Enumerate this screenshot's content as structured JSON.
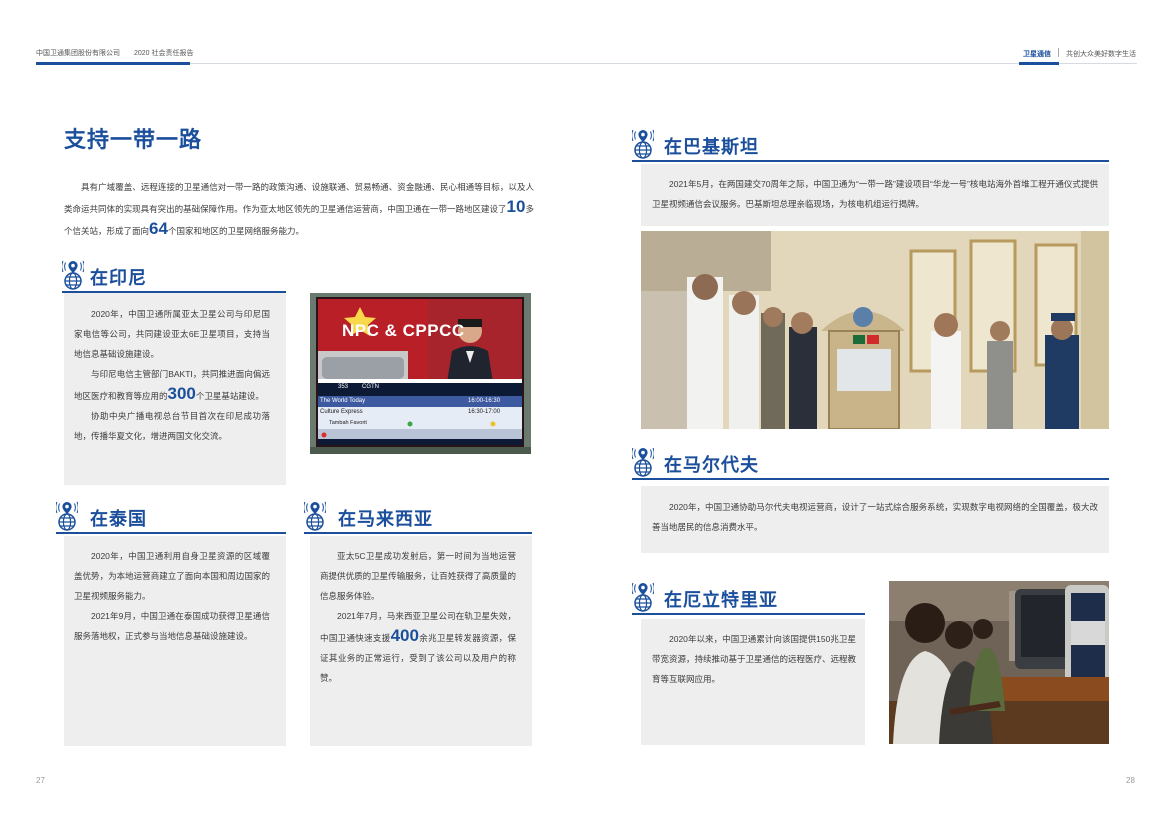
{
  "header": {
    "company": "中国卫通集团股份有限公司",
    "report": "2020 社会责任报告",
    "brand": "卫星通信",
    "slogan": "共创大众美好数字生活"
  },
  "title": "支持一带一路",
  "intro": {
    "part1": "具有广域覆盖、远程连接的卫星通信对一带一路的政策沟通、设施联通、贸易畅通、资金融通、民心相通等目标，以及人类命运共同体的实现具有突出的基础保障作用。作为亚太地区领先的卫星通信运营商，中国卫通在一带一路地区建设了",
    "num1": "10",
    "part2": "多个信关站，形成了面向",
    "num2": "64",
    "part3": "个国家和地区的卫星网络服务能力。"
  },
  "sections": {
    "indonesia": {
      "title": "在印尼",
      "p1": "2020年，中国卫通所属亚太卫星公司与印尼国家电信等公司，共同建设亚太6E卫星项目，支持当地信息基础设施建设。",
      "p2a": "与印尼电信主管部门BAKTI，共同推进面向偏远地区医疗和教育等应用的",
      "p2num": "300",
      "p2b": "个卫星基站建设。",
      "p3": "协助中央广播电视总台节目首次在印尼成功落地，传播华夏文化，增进两国文化交流。"
    },
    "thailand": {
      "title": "在泰国",
      "p1": "2020年，中国卫通利用自身卫星资源的区域覆盖优势，为本地运营商建立了面向本国和周边国家的卫星视频服务能力。",
      "p2": "2021年9月，中国卫通在泰国成功获得卫星通信服务落地权，正式参与当地信息基础设施建设。"
    },
    "malaysia": {
      "title": "在马来西亚",
      "p1": "亚太5C卫星成功发射后，第一时间为当地运营商提供优质的卫星传输服务，让百姓获得了高质量的信息服务体验。",
      "p2a": "2021年7月，马来西亚卫星公司在轨卫星失效，中国卫通快速支援",
      "p2num": "400",
      "p2b": "余兆卫星转发器资源，保证其业务的正常运行，受到了该公司以及用户的称赞。"
    },
    "pakistan": {
      "title": "在巴基斯坦",
      "p1": "2021年5月，在两国建交70周年之际，中国卫通为“一带一路”建设项目“华龙一号”核电站海外首堆工程开通仪式提供卫星视频通信会议服务。巴基斯坦总理亲临现场，为核电机组运行揭牌。"
    },
    "maldives": {
      "title": "在马尔代夫",
      "p1": "2020年，中国卫通协助马尔代夫电视运营商，设计了一站式综合服务系统，实现数字电视网络的全国覆盖，极大改善当地居民的信息消费水平。"
    },
    "eritrea": {
      "title": "在厄立特里亚",
      "p1": "2020年以来，中国卫通累计向该国提供150兆卫星带宽资源，持续推动基于卫星通信的远程医疗、远程教育等互联网应用。"
    }
  },
  "tv_photo": {
    "banner": "NPC & CPPCC",
    "channel_num": "353",
    "channel_name": "CGTN",
    "rows": [
      {
        "name": "The World Today",
        "time": "16:00-16:30"
      },
      {
        "name": "Culture Express",
        "time": "16:30-17:00"
      },
      {
        "name": "Tambah Favorit",
        "time": ""
      }
    ]
  },
  "page_numbers": {
    "left": "27",
    "right": "28"
  },
  "colors": {
    "brand_blue": "#1b4f9c",
    "box_gray": "#eeeeee"
  }
}
